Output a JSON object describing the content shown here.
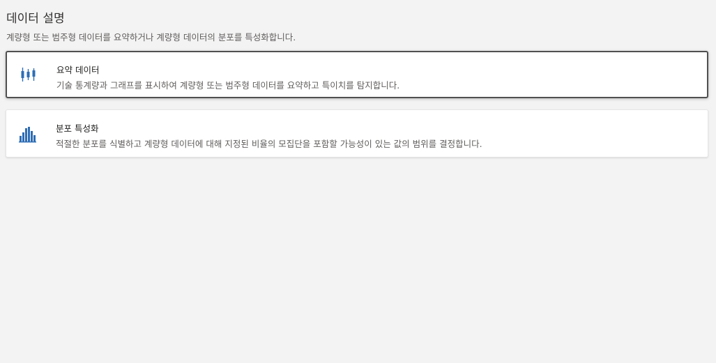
{
  "page": {
    "title": "데이터 설명",
    "subtitle": "계량형 또는 범주형 데이터를 요약하거나 계량형 데이터의 분포를 특성화합니다."
  },
  "options": [
    {
      "icon": "candlestick-chart-icon",
      "title": "요약 데이터",
      "description": "기술 통계량과 그래프를 표시하여 계량형 또는 범주형 데이터를 요약하고 특이치를 탐지합니다.",
      "selected": true
    },
    {
      "icon": "histogram-icon",
      "title": "분포 특성화",
      "description": "적절한 분포를 식별하고 계량형 데이터에 대해 지정된 비율의 모집단을 포함할 가능성이 있는 값의 범위를 결정합니다.",
      "selected": false
    }
  ],
  "colors": {
    "icon_blue": "#2e6db4",
    "background": "#f3f3f3",
    "card": "#ffffff",
    "selected_border": "#505050"
  }
}
